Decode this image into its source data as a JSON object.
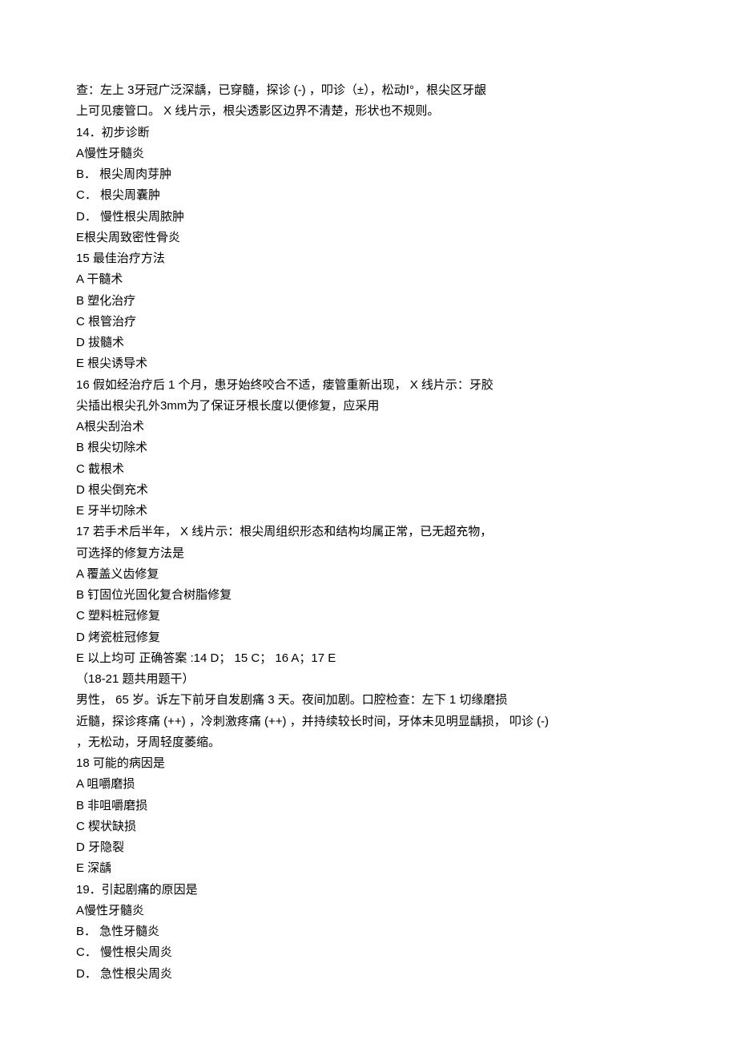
{
  "lines": [
    "查：左上 3牙冠广泛深龋，已穿髓，探诊 (-) ，叩诊（±），松动Ⅰ°，根尖区牙龈",
    "上可见瘘管口。 X 线片示，根尖透影区边界不清楚，形状也不规则。",
    "14．初步诊断",
    "A慢性牙髓炎",
    "B． 根尖周肉芽肿",
    "C． 根尖周囊肿",
    "D． 慢性根尖周脓肿",
    "E根尖周致密性骨炎",
    "15  最佳治疗方法",
    "A 干髓术",
    "B 塑化治疗",
    "C 根管治疗",
    "D 拔髓术",
    "E 根尖诱导术",
    "16  假如经治疗后 1 个月，患牙始终咬合不适，瘘管重新出现， X 线片示：牙胶",
    "尖插出根尖孔外3mm为了保证牙根长度以便修复，应采用",
    "A根尖刮治术",
    "B 根尖切除术",
    "C 截根术",
    "D 根尖倒充术",
    "E 牙半切除术",
    "17  若手术后半年， X 线片示：根尖周组织形态和结构均属正常，已无超充物，",
    "可选择的修复方法是",
    "A 覆盖义齿修复",
    "B 钉固位光固化复合树脂修复",
    "C 塑料桩冠修复",
    "D 烤瓷桩冠修复",
    "E 以上均可  正确答案 :14 D； 15 C； 16 A；17 E",
    "（18-21 题共用题干）",
    "男性， 65 岁。诉左下前牙自发剧痛 3 天。夜间加剧。口腔检查：左下 1 切缘磨损",
    "近髓，探诊疼痛 (++) ，冷刺激疼痛 (++) ，并持续较长时间，牙体未见明显龋损， 叩诊 (-)",
    "，无松动，牙周轻度萎缩。",
    "18  可能的病因是",
    "A 咀嚼磨损",
    "B 非咀嚼磨损",
    "C 楔状缺损",
    "D 牙隐裂",
    "E 深龋",
    "19．引起剧痛的原因是",
    "A慢性牙髓炎",
    "B． 急性牙髓炎",
    "C． 慢性根尖周炎",
    "D． 急性根尖周炎"
  ]
}
